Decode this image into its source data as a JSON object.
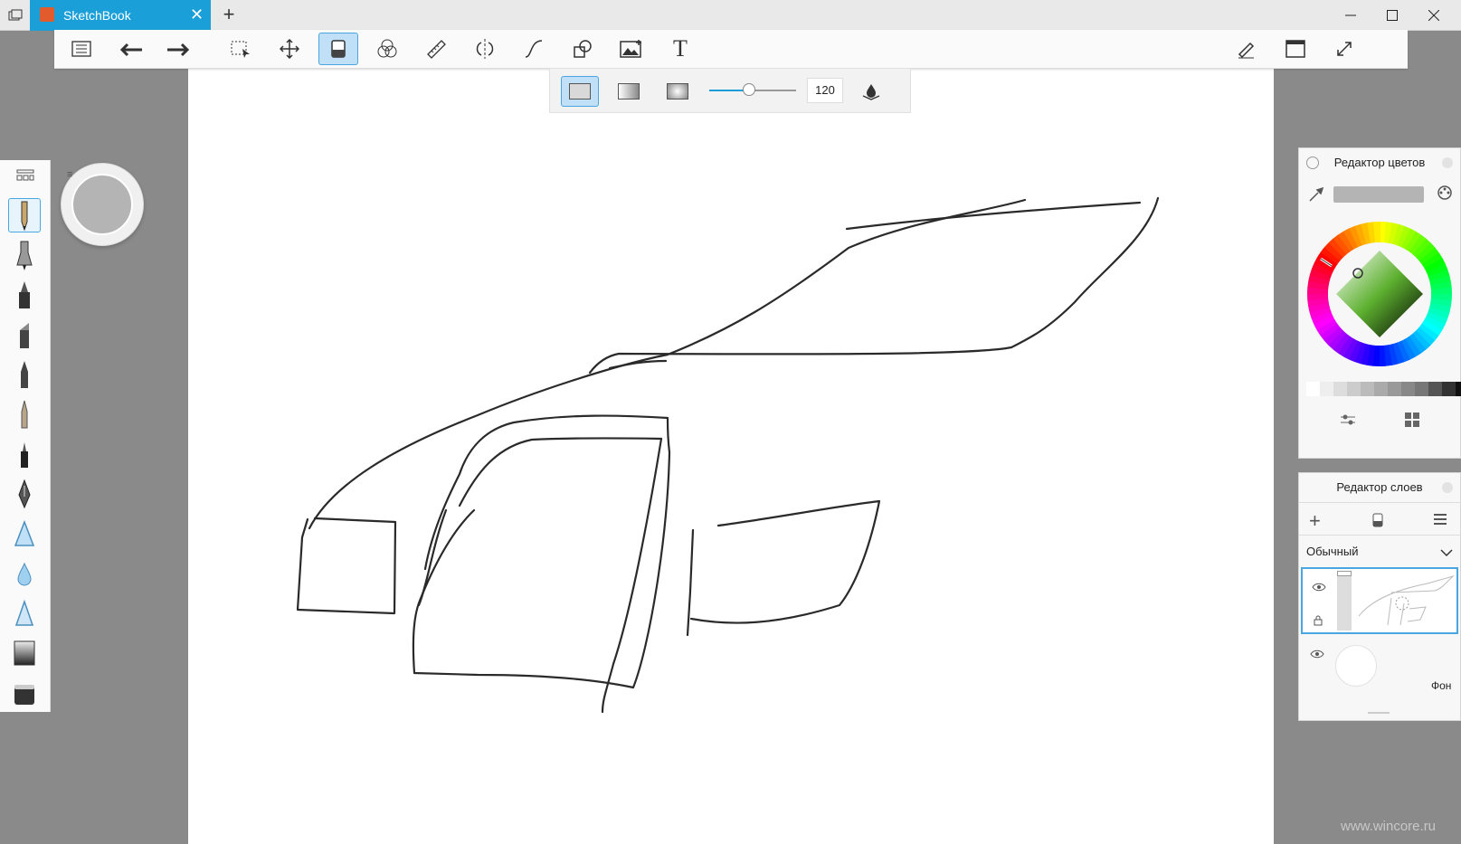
{
  "app": {
    "tab_title": "SketchBook",
    "tab_close": "✕",
    "new_tab": "+"
  },
  "window_controls": {
    "minimize": "—",
    "maximize": "☐",
    "close": "✕"
  },
  "toolbar": {
    "items": [
      "list-icon",
      "undo-icon",
      "redo-icon",
      "select-icon",
      "move-icon",
      "fill-icon",
      "color-blend-icon",
      "ruler-icon",
      "symmetry-icon",
      "curve-icon",
      "shapes-icon",
      "image-icon",
      "text-icon"
    ],
    "right_items": [
      "pencil-settings-icon",
      "window-icon",
      "fullscreen-icon"
    ],
    "active": "fill-icon",
    "text_tool_label": "T"
  },
  "fill_bar": {
    "modes": [
      "solid",
      "linear-gradient",
      "radial-gradient"
    ],
    "active_mode": "solid",
    "tolerance": "120",
    "tolerance_level": 0.46
  },
  "brush_palette": {
    "items": [
      "pencil",
      "inking-pen",
      "marker",
      "chisel-marker",
      "ballpoint-pen",
      "fine-brush",
      "technical-pen",
      "fountain-pen",
      "airbrush",
      "water-drop",
      "triangle-brush",
      "eraser-hard",
      "eraser-soft"
    ],
    "active": "pencil"
  },
  "color_editor": {
    "title": "Редактор цветов",
    "current_color": "#b4b4b4",
    "accent": "#1a9fd9",
    "grays": [
      "#ffffff",
      "#eeeeee",
      "#dddddd",
      "#cccccc",
      "#bbbbbb",
      "#aaaaaa",
      "#999999",
      "#888888",
      "#777777",
      "#555555",
      "#333333",
      "#111111"
    ]
  },
  "layer_editor": {
    "title": "Редактор слоев",
    "blend_mode": "Обычный",
    "layers": [
      {
        "name": "",
        "selected": true
      },
      {
        "name": "Фон",
        "selected": false
      }
    ]
  },
  "watermark": "www.wincore.ru"
}
